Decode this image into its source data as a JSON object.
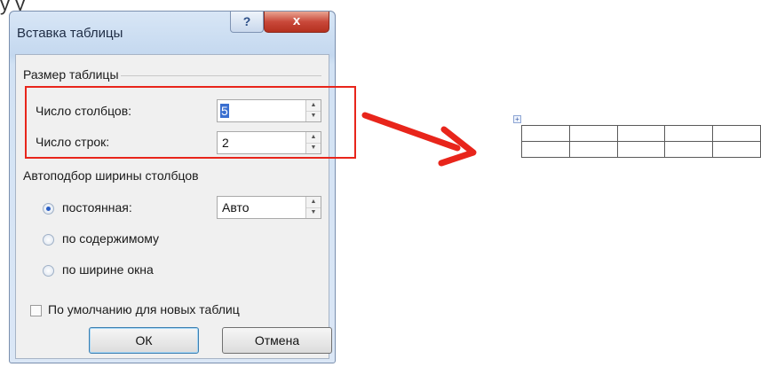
{
  "dialog": {
    "title": "Вставка таблицы",
    "help_label": "?",
    "close_label": "x",
    "size_group": {
      "label": "Размер таблицы",
      "columns_label": "Число столбцов:",
      "columns_value": "5",
      "rows_label": "Число строк:",
      "rows_value": "2"
    },
    "autofit_group": {
      "label": "Автоподбор ширины столбцов",
      "options": [
        {
          "label": "постоянная:",
          "checked": true
        },
        {
          "label": "по содержимому",
          "checked": false
        },
        {
          "label": "по ширине окна",
          "checked": false
        }
      ],
      "fixed_value": "Авто"
    },
    "default_checkbox_label": "По умолчанию для новых таблиц",
    "ok_label": "ОК",
    "cancel_label": "Отмена"
  },
  "annotation": {
    "arrow_color": "#e8251b",
    "highlight_color": "#e8251b"
  },
  "result_table": {
    "rows": 2,
    "columns": 5
  },
  "colors": {
    "dialog_frame": "#c4d8ef",
    "close_button": "#c9493a",
    "selection": "#3a6fd0"
  }
}
